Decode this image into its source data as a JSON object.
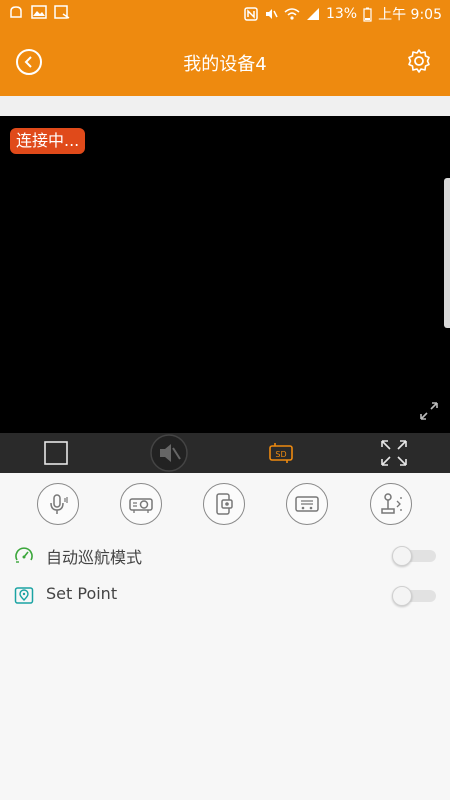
{
  "status_bar": {
    "battery": "13%",
    "time": "上午 9:05"
  },
  "header": {
    "title": "我的设备4"
  },
  "video": {
    "status_badge": "连接中..."
  },
  "settings": [
    {
      "label": "自动巡航模式",
      "icon": "speedometer-icon",
      "icon_color": "#3aa63a",
      "enabled": false
    },
    {
      "label": "Set Point",
      "icon": "location-pin-icon",
      "icon_color": "#1aa3a3",
      "enabled": false
    }
  ],
  "colors": {
    "accent": "#ee8a0f",
    "badge": "#e04a1a",
    "sd_icon": "#ee8a0f"
  }
}
